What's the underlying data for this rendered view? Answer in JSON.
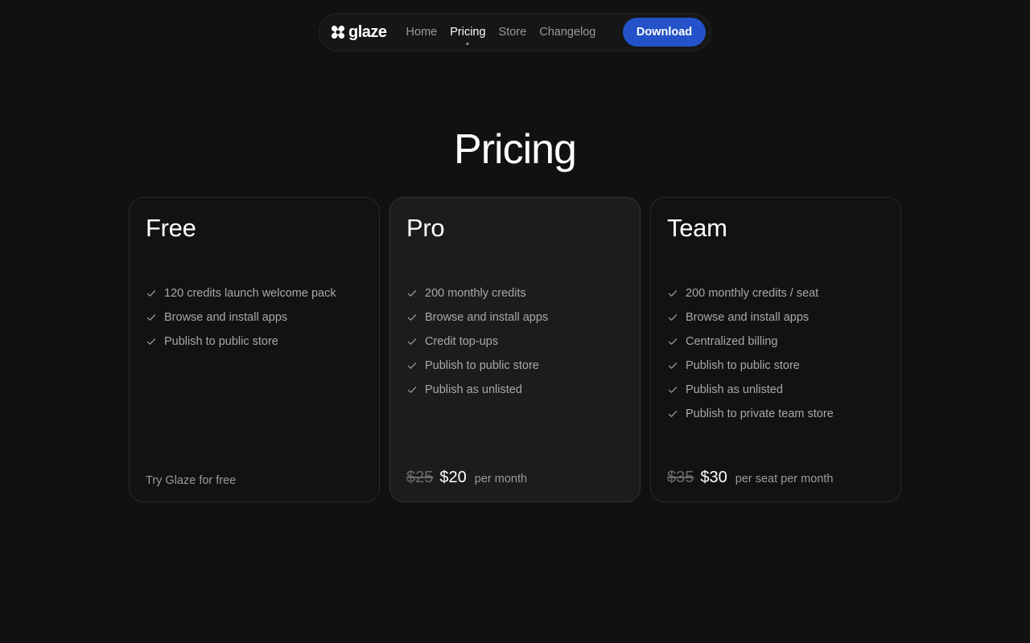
{
  "nav": {
    "logo_text": "glaze",
    "links": [
      {
        "label": "Home",
        "active": false
      },
      {
        "label": "Pricing",
        "active": true
      },
      {
        "label": "Store",
        "active": false
      },
      {
        "label": "Changelog",
        "active": false
      }
    ],
    "download_label": "Download",
    "accent_color": "#2352c9"
  },
  "page": {
    "title": "Pricing"
  },
  "plans": [
    {
      "name": "Free",
      "features": [
        "120 credits launch welcome pack",
        "Browse and install apps",
        "Publish to public store"
      ],
      "footer_note": "Try Glaze for free"
    },
    {
      "name": "Pro",
      "features": [
        "200 monthly credits",
        "Browse and install apps",
        "Credit top-ups",
        "Publish to public store",
        "Publish as unlisted"
      ],
      "old_price": "$25",
      "price": "$20",
      "period": "per month"
    },
    {
      "name": "Team",
      "features": [
        "200 monthly credits / seat",
        "Browse and install apps",
        "Centralized billing",
        "Publish to public store",
        "Publish as unlisted",
        "Publish to private team store"
      ],
      "old_price": "$35",
      "price": "$30",
      "period": "per seat per month"
    }
  ],
  "icons": {
    "logo": "glaze-logo-icon",
    "feature": "check-icon"
  }
}
